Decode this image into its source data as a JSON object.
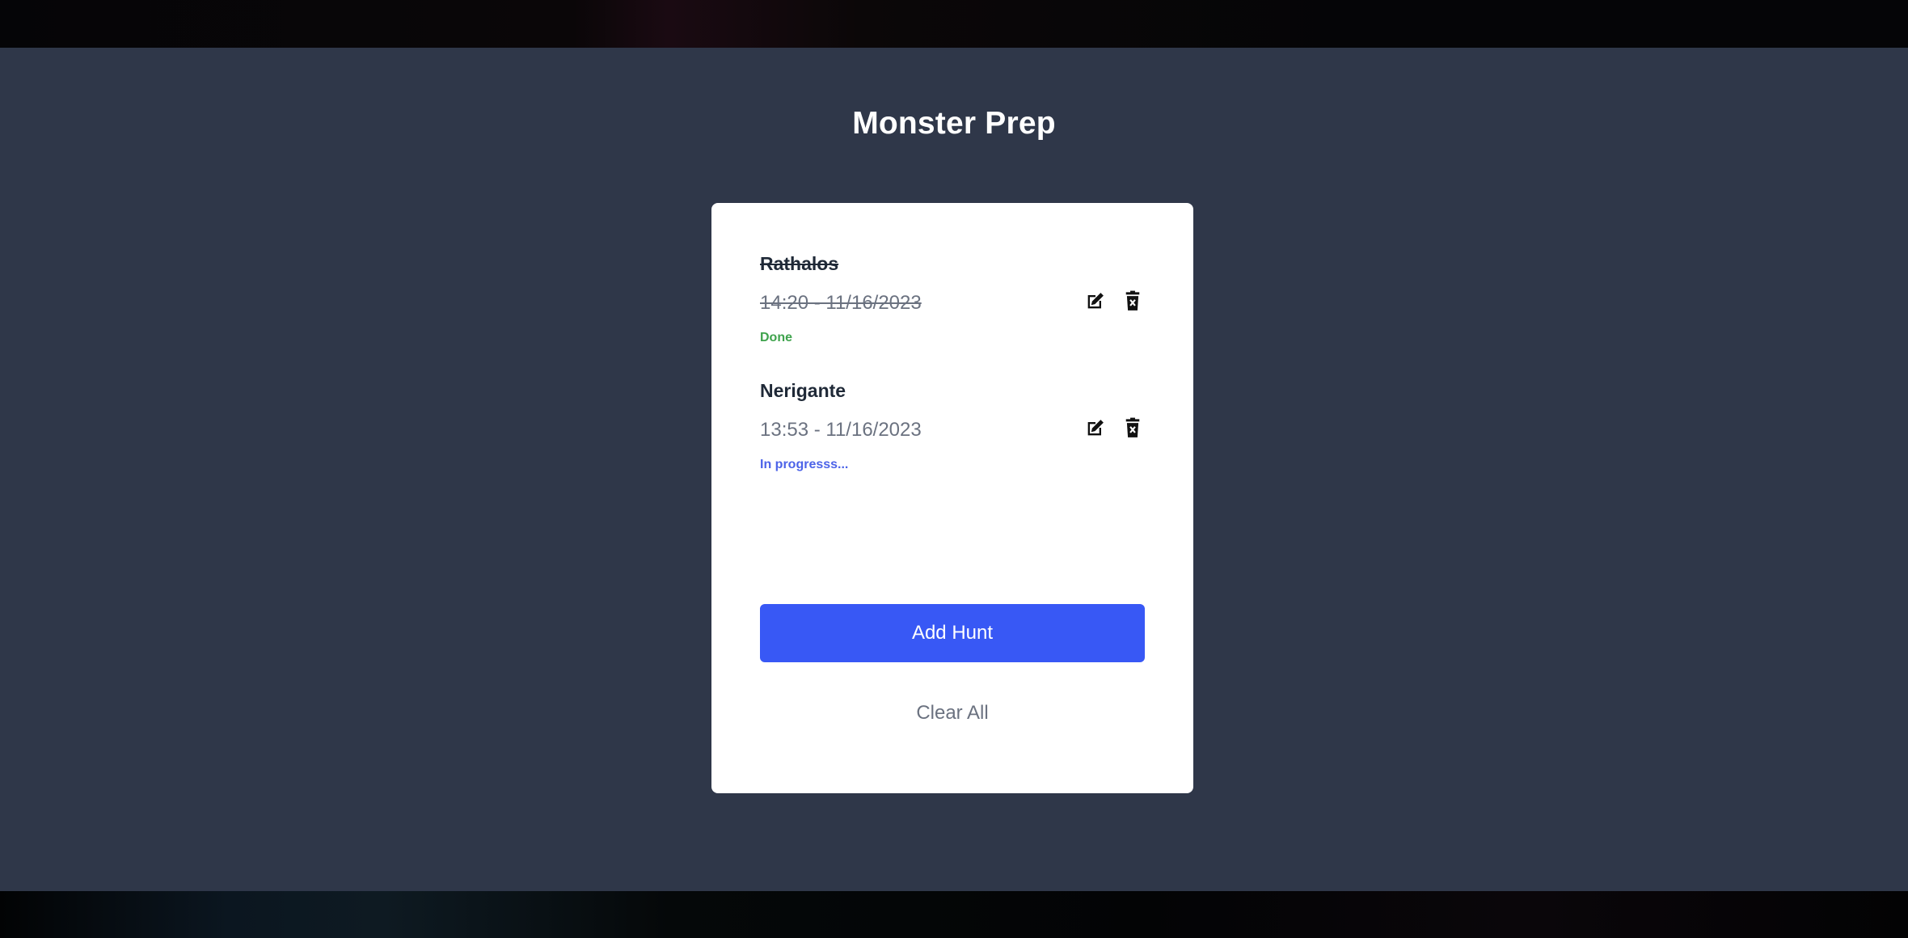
{
  "app": {
    "title": "Monster Prep"
  },
  "hunts": [
    {
      "name": "Rathalos",
      "time": "14:20 - 11/16/2023",
      "status": "Done",
      "done": true,
      "edit_icon": "edit-icon",
      "delete_icon": "trash-icon"
    },
    {
      "name": "Nerigante",
      "time": "13:53 - 11/16/2023",
      "status": "In progresss...",
      "done": false,
      "edit_icon": "edit-icon",
      "delete_icon": "trash-icon"
    }
  ],
  "actions": {
    "add_label": "Add Hunt",
    "clear_label": "Clear All"
  },
  "colors": {
    "background": "#2f3749",
    "card": "#ffffff",
    "accent": "#3858f5",
    "status_done": "#3fa34d",
    "status_progress": "#4c63e8"
  }
}
